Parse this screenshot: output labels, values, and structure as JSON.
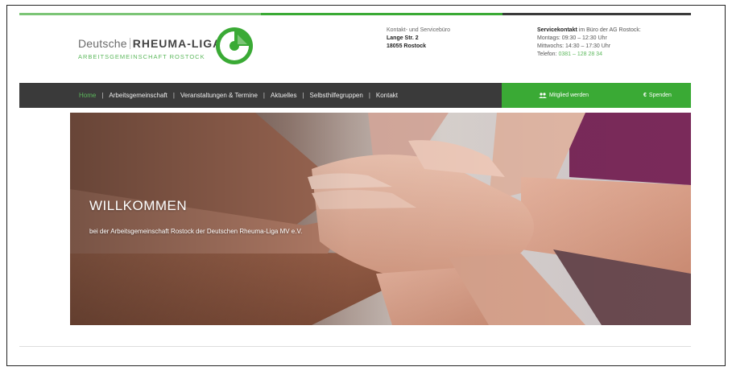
{
  "header": {
    "logo": {
      "line1_a": "Deutsche",
      "line1_b": "RHEUMA-LIGA",
      "line2": "ARBEITSGEMEINSCHAFT ROSTOCK"
    },
    "contact": {
      "title": "Kontakt- und Servicebüro",
      "street": "Lange Str. 2",
      "city": "18055 Rostock"
    },
    "service": {
      "label_bold": "Servicekontakt",
      "label_rest": " im Büro der AG Rostock:",
      "monday": "Montags: 09:30 – 12:30 Uhr",
      "wednesday": "Mittwochs: 14:30 – 17:30 Uhr",
      "phone_label": "Telefon: ",
      "phone": "0381 – 128 28 34"
    }
  },
  "nav": {
    "items": [
      "Home",
      "Arbeitsgemeinschaft",
      "Veranstaltungen & Termine",
      "Aktuelles",
      "Selbsthilfegruppen",
      "Kontakt"
    ],
    "separator": "|",
    "join": "Mitglied werden",
    "donate": "Spenden"
  },
  "hero": {
    "title": "WILLKOMMEN",
    "subtitle": "bei der Arbeitsgemeinschaft Rostock der Deutschen Rheuma-Liga MV e.V."
  },
  "colors": {
    "brand_green": "#3aaa35",
    "light_green": "#7cc576",
    "nav_dark": "#3a3a3a"
  }
}
